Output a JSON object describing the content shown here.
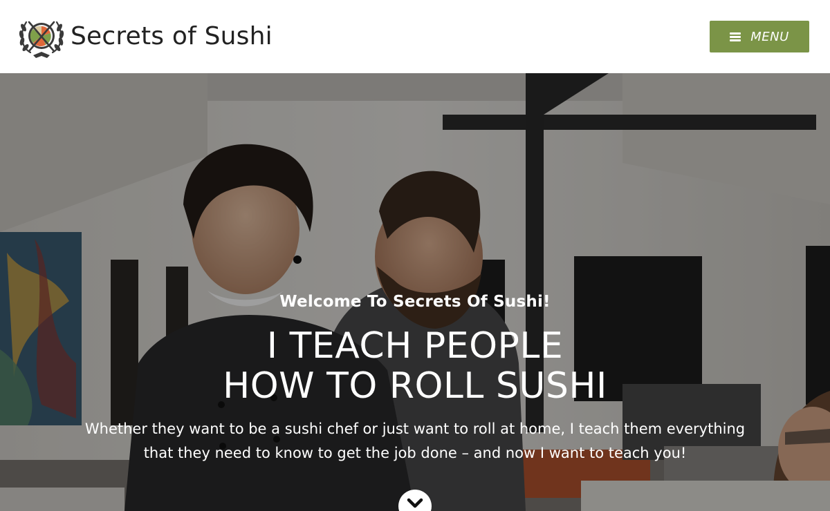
{
  "header": {
    "site_name": "Secrets of Sushi",
    "menu_label": "MENU",
    "menu_color": "#7b9447"
  },
  "hero": {
    "kicker": "Welcome To Secrets Of Sushi!",
    "title_line1": "I TEACH PEOPLE",
    "title_line2": "HOW TO ROLL SUSHI",
    "text": "Whether they want to be a sushi chef or just want to roll at home, I teach them everything that they need to know to get the job done – and now I want to teach you!",
    "scroll_icon": "chevron-down-icon"
  },
  "icons": {
    "logo": "sushi-laurel-logo-icon",
    "menu": "hamburger-icon"
  }
}
